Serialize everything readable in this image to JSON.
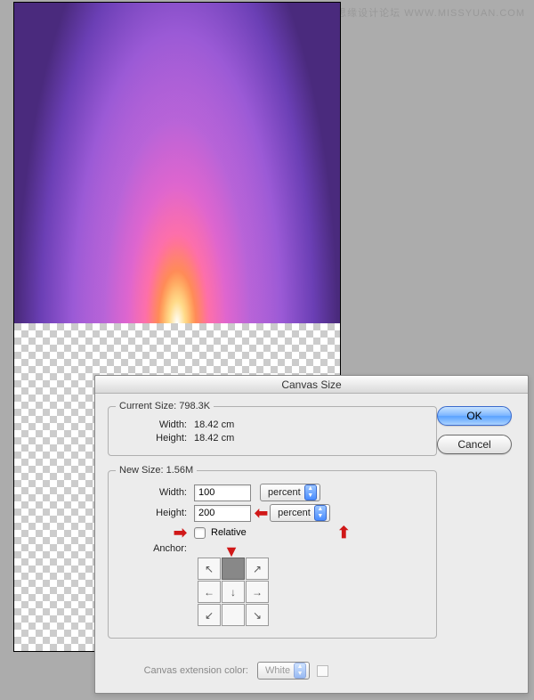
{
  "watermark": "思缘设计论坛  WWW.MISSYUAN.COM",
  "dialog": {
    "title": "Canvas Size",
    "current": {
      "legend": "Current Size:",
      "size": "798.3K",
      "width_label": "Width:",
      "width_value": "18.42 cm",
      "height_label": "Height:",
      "height_value": "18.42 cm"
    },
    "new": {
      "legend": "New Size:",
      "size": "1.56M",
      "width_label": "Width:",
      "width_value": "100",
      "width_unit": "percent",
      "height_label": "Height:",
      "height_value": "200",
      "height_unit": "percent",
      "relative_label": "Relative",
      "relative_checked": false,
      "anchor_label": "Anchor:",
      "anchor_position": "top-center"
    },
    "extension": {
      "label": "Canvas extension color:",
      "value": "White"
    },
    "buttons": {
      "ok": "OK",
      "cancel": "Cancel"
    }
  }
}
